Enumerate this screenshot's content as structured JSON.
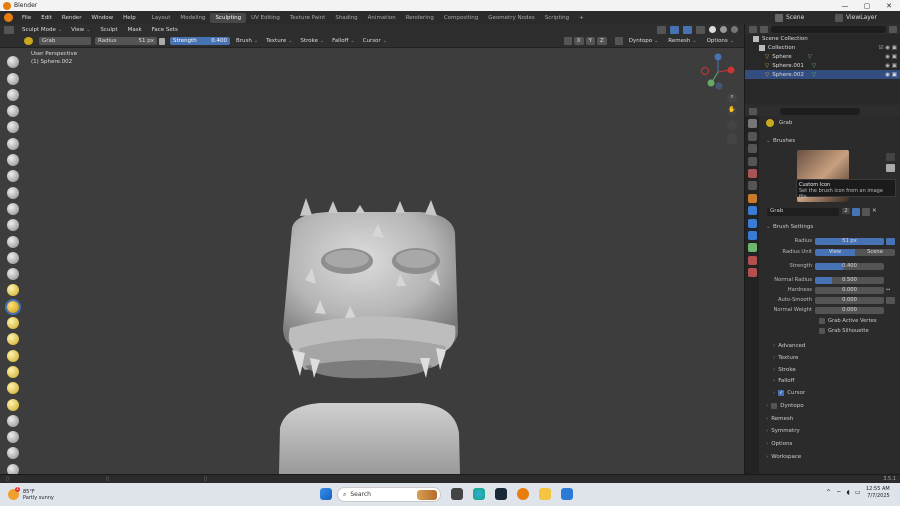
{
  "window": {
    "title": "Blender",
    "controls": [
      "—",
      "▢",
      "✕"
    ]
  },
  "menu": {
    "items": [
      "File",
      "Edit",
      "Render",
      "Window",
      "Help"
    ],
    "workspaces": [
      "Layout",
      "Modeling",
      "Sculpting",
      "UV Editing",
      "Texture Paint",
      "Shading",
      "Animation",
      "Rendering",
      "Compositing",
      "Geometry Nodes",
      "Scripting",
      "+"
    ],
    "active_workspace": "Sculpting",
    "scene": "Scene",
    "view_layer": "ViewLayer"
  },
  "viewport_header": {
    "mode": "Sculpt Mode",
    "menus": [
      "View",
      "Sculpt",
      "Mask",
      "Face Sets"
    ]
  },
  "tool_header": {
    "brush_name": "Grab",
    "radius_label": "Radius",
    "radius_value": "51 px",
    "strength_label": "Strength",
    "strength_value": "0.400",
    "menus": [
      "Brush",
      "Texture",
      "Stroke",
      "Falloff",
      "Cursor"
    ],
    "xyz": [
      "X",
      "Y",
      "Z"
    ],
    "right_menus": [
      "Dyntopo",
      "Remesh",
      "Options"
    ]
  },
  "viewport": {
    "perspective": "User Perspective",
    "object_label": "(1) Sphere.002",
    "background_color": "#3d3d3d",
    "mesh_color": "#c9c9c9"
  },
  "outliner": {
    "search_placeholder": "",
    "items": [
      {
        "label": "Scene Collection",
        "indent": 0,
        "selected": false
      },
      {
        "label": "Collection",
        "indent": 1,
        "selected": false
      },
      {
        "label": "Sphere",
        "indent": 2,
        "selected": false
      },
      {
        "label": "Sphere.001",
        "indent": 2,
        "selected": false
      },
      {
        "label": "Sphere.002",
        "indent": 2,
        "selected": true
      }
    ]
  },
  "properties": {
    "brush_title": "Grab",
    "brushes_panel": "Brushes",
    "tooltip_title": "Custom Icon",
    "tooltip_text": "Set the brush icon from an image file.",
    "brush_field": "Grab",
    "brush_users": "2",
    "brush_settings": "Brush Settings",
    "rows": [
      {
        "label": "Radius",
        "value": "51 px",
        "fill": 1.0
      },
      {
        "label": "Radius Unit",
        "value": "View",
        "alt": "Scene"
      },
      {
        "label": "Strength",
        "value": "0.400",
        "fill": 0.4
      },
      {
        "label": "Normal Radius",
        "value": "0.500",
        "fill": 0.5
      },
      {
        "label": "Hardness",
        "value": "0.000",
        "fill": 0
      },
      {
        "label": "Auto-Smooth",
        "value": "0.000",
        "fill": 0
      },
      {
        "label": "Normal Weight",
        "value": "0.000",
        "fill": 0
      }
    ],
    "checkboxes": [
      "Grab Active Vertex",
      "Grab Silhouette"
    ],
    "subsections": [
      "Advanced",
      "Texture",
      "Stroke",
      "Falloff",
      "Cursor"
    ],
    "cursor_checked": true,
    "dyntopo": "Dyntopo",
    "panels": [
      "Remesh",
      "Symmetry",
      "Options",
      "Workspace"
    ]
  },
  "status": {
    "version": "3.5.1"
  },
  "taskbar": {
    "weather_temp": "85°F",
    "weather_desc": "Partly sunny",
    "search_placeholder": "Search",
    "time": "12:55 AM",
    "date": "7/7/2025",
    "notification_count": "1"
  }
}
